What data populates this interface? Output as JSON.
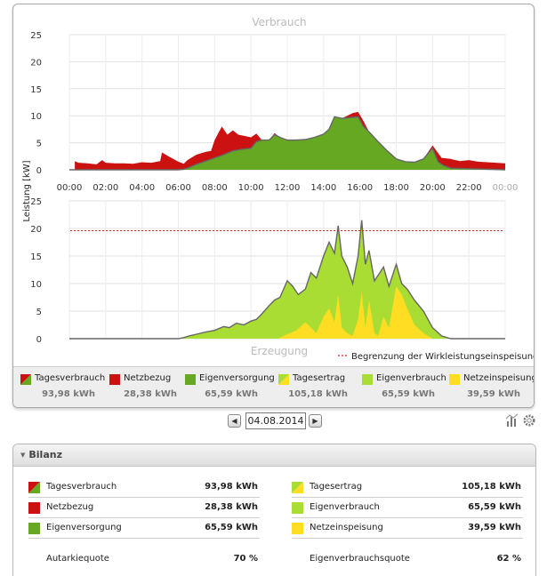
{
  "top_chart": {
    "title": "Verbrauch",
    "y_ticks": [
      "25",
      "20",
      "15",
      "10",
      "5",
      "0"
    ],
    "x_ticks": [
      "00:00",
      "02:00",
      "04:00",
      "06:00",
      "08:00",
      "10:00",
      "12:00",
      "14:00",
      "16:00",
      "18:00",
      "20:00",
      "22:00",
      "00:00"
    ]
  },
  "bottom_chart": {
    "title": "Erzeugung",
    "y_ticks": [
      "25",
      "20",
      "15",
      "10",
      "5",
      "0"
    ],
    "limit_label": "Begrenzung der Wirkleistungseinspeisung"
  },
  "y_axis_label": "Leistung [kW]",
  "colors": {
    "netzbezug": "#cc1111",
    "eigenversorgung": "#66a821",
    "eigenverbrauch": "#aadd33",
    "netzeinspeisung": "#ffdd22",
    "limit": "#dd2222",
    "outline": "#666666"
  },
  "chart_data": [
    {
      "type": "area",
      "title": "Verbrauch",
      "ylabel": "Leistung [kW]",
      "ylim": [
        0,
        25
      ],
      "x_unit": "hours",
      "series": [
        {
          "name": "Netzbezug",
          "x": [
            0.3,
            0.5,
            1,
            1.5,
            1.8,
            2,
            2.5,
            3,
            3.5,
            4,
            4.5,
            5,
            5.1,
            5.5,
            6,
            6.3,
            6.5,
            7,
            7.5,
            7.8,
            8,
            8.2,
            8.4,
            8.7,
            9,
            9.3,
            9.6,
            10,
            10.3,
            10.6,
            11,
            11.3,
            11.6,
            12,
            12.5,
            13,
            13.5,
            14,
            14.3,
            14.6,
            15,
            15.3,
            15.6,
            15.9,
            16.2,
            16.5,
            17,
            17.5,
            18,
            18.5,
            19,
            19.5,
            20,
            20.5,
            21,
            21.5,
            22,
            22.5,
            23,
            23.5,
            24
          ],
          "values": [
            1.6,
            1.3,
            1.2,
            1.0,
            1.8,
            1.3,
            1.2,
            1.2,
            1.1,
            1.4,
            1.3,
            1.6,
            3.2,
            2.4,
            1.5,
            1.1,
            1.8,
            2.8,
            3.3,
            3.5,
            5.5,
            6.8,
            8.0,
            6.5,
            7.3,
            6.5,
            6.3,
            6.0,
            6.7,
            5.5,
            5.5,
            6.8,
            6.0,
            5.5,
            5.5,
            5.6,
            6.0,
            6.6,
            7.5,
            9.8,
            9.5,
            10.0,
            10.5,
            10.7,
            9.0,
            7.0,
            5.2,
            3.5,
            2.0,
            1.5,
            1.4,
            2.0,
            4.5,
            2.2,
            2.0,
            1.6,
            1.8,
            1.5,
            1.4,
            1.3,
            1.2
          ]
        },
        {
          "name": "Eigenversorgung",
          "x": [
            0,
            6,
            6.3,
            6.5,
            7,
            7.5,
            8,
            8.5,
            9,
            9.5,
            10,
            10.3,
            10.6,
            11,
            11.3,
            11.6,
            12,
            12.5,
            13,
            13.5,
            14,
            14.3,
            14.6,
            15,
            15.3,
            15.6,
            15.9,
            16.2,
            16.5,
            17,
            17.5,
            18,
            18.5,
            19,
            19.5,
            20,
            20.3,
            20.6,
            21,
            24
          ],
          "values": [
            0,
            0,
            0.1,
            0.3,
            1.0,
            1.6,
            2.2,
            2.8,
            3.5,
            3.8,
            4.0,
            5.2,
            5.5,
            5.5,
            6.5,
            6.0,
            5.5,
            5.5,
            5.6,
            6.0,
            6.6,
            7.5,
            9.8,
            9.5,
            9.6,
            9.7,
            9.8,
            8.0,
            7.0,
            5.2,
            3.5,
            2.0,
            1.5,
            1.4,
            2.0,
            4.0,
            1.5,
            0.8,
            0.3,
            0
          ]
        }
      ]
    },
    {
      "type": "area",
      "title": "Erzeugung",
      "ylabel": "Leistung [kW]",
      "ylim": [
        0,
        25
      ],
      "limit": 19.6,
      "series": [
        {
          "name": "Tagesertrag",
          "x": [
            0,
            6,
            6.3,
            6.6,
            7,
            7.5,
            8,
            8.5,
            8.8,
            9.2,
            9.6,
            10,
            10.3,
            10.6,
            11,
            11.3,
            11.6,
            12,
            12.3,
            12.6,
            13,
            13.3,
            13.6,
            14,
            14.3,
            14.6,
            14.8,
            15,
            15.3,
            15.6,
            15.9,
            16.1,
            16.3,
            16.5,
            16.8,
            17,
            17.3,
            17.6,
            18,
            18.3,
            18.6,
            19,
            19.5,
            20,
            20.5,
            21,
            24
          ],
          "values": [
            0,
            0,
            0.2,
            0.5,
            0.8,
            1.2,
            1.5,
            2.2,
            2.0,
            2.8,
            2.5,
            3.2,
            3.5,
            4.5,
            6.0,
            7.0,
            7.5,
            10.5,
            9.5,
            8.0,
            9.0,
            12.0,
            11.0,
            15.0,
            17.5,
            15.5,
            20.5,
            15.0,
            13.0,
            10.0,
            15.0,
            21.5,
            13.5,
            16.0,
            10.5,
            11.5,
            13.0,
            9.5,
            13.5,
            10.0,
            9.0,
            7.0,
            5.0,
            2.0,
            0.5,
            0,
            0
          ]
        },
        {
          "name": "Netzeinspeisung",
          "x": [
            0,
            11.5,
            12,
            12.5,
            13,
            13.3,
            13.6,
            14,
            14.3,
            14.6,
            14.8,
            15,
            15.3,
            15.6,
            15.9,
            16.1,
            16.3,
            16.5,
            16.8,
            17,
            17.3,
            17.6,
            18,
            18.3,
            18.6,
            19,
            19.5,
            20,
            24
          ],
          "values": [
            0,
            0,
            0.8,
            1.5,
            3.0,
            2.0,
            1.0,
            4.0,
            5.5,
            3.0,
            8.0,
            2.0,
            1.0,
            0.5,
            3.5,
            8.5,
            2.0,
            7.0,
            1.0,
            0.5,
            4.0,
            2.0,
            9.5,
            8.0,
            5.5,
            2.5,
            1.0,
            0,
            0
          ]
        }
      ]
    }
  ],
  "legend": [
    {
      "label": "Tagesverbrauch",
      "value": "93,98 kWh",
      "swatch": "split-red-green"
    },
    {
      "label": "Netzbezug",
      "value": "28,38 kWh",
      "swatch": "red"
    },
    {
      "label": "Eigenversorgung",
      "value": "65,59 kWh",
      "swatch": "green"
    },
    {
      "label": "Tagesertrag",
      "value": "105,18 kWh",
      "swatch": "split-lime-yellow"
    },
    {
      "label": "Eigenverbrauch",
      "value": "65,59 kWh",
      "swatch": "lime"
    },
    {
      "label": "Netzeinspeisung",
      "value": "39,59 kWh",
      "swatch": "yellow"
    }
  ],
  "date_nav": {
    "date": "04.08.2014",
    "prev_icon": "prev-arrow-icon",
    "next_icon": "next-arrow-icon"
  },
  "tools": {
    "settings_icon": "settings-gear-icon",
    "chart_icon": "chart-options-icon"
  },
  "bilanz": {
    "title": "Bilanz",
    "left": [
      {
        "label": "Tagesverbrauch",
        "value": "93,98 kWh"
      },
      {
        "label": "Netzbezug",
        "value": "28,38 kWh"
      },
      {
        "label": "Eigenversorgung",
        "value": "65,59 kWh"
      },
      {
        "label": "Autarkiequote",
        "value": "70 %"
      }
    ],
    "right": [
      {
        "label": "Tagesertrag",
        "value": "105,18 kWh"
      },
      {
        "label": "Eigenverbrauch",
        "value": "65,59 kWh"
      },
      {
        "label": "Netzeinspeisung",
        "value": "39,59 kWh"
      },
      {
        "label": "Eigenverbrauchsquote",
        "value": "62 %"
      }
    ]
  }
}
